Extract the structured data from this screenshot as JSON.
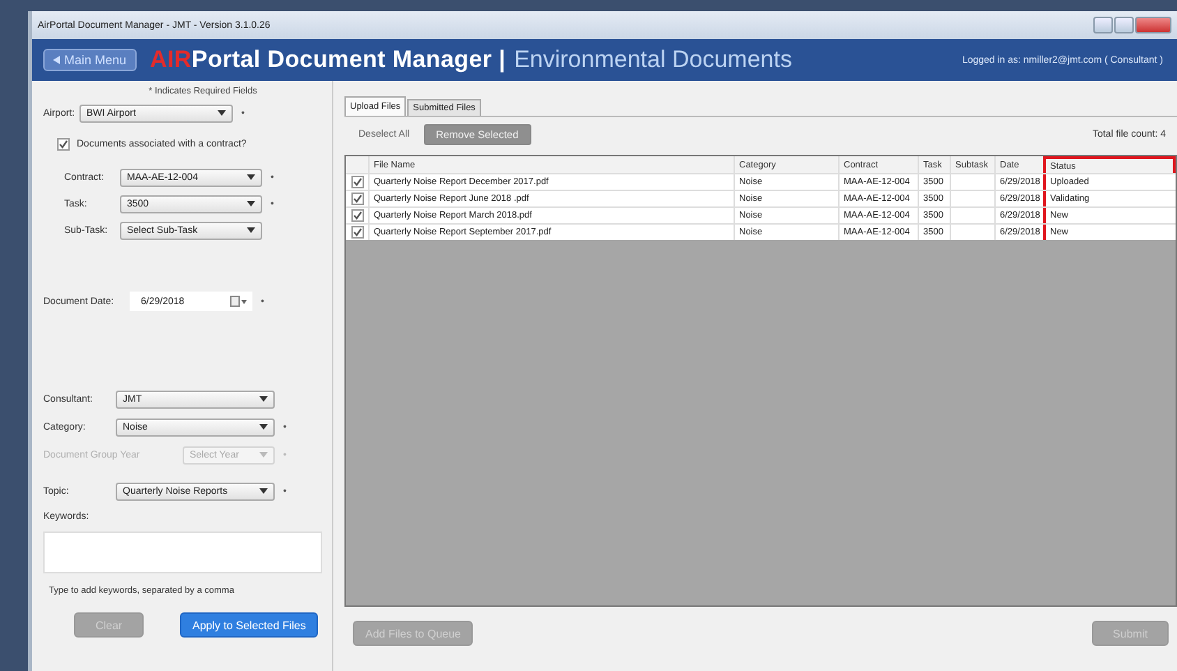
{
  "window": {
    "title": "AirPortal Document Manager - JMT - Version 3.1.0.26"
  },
  "header": {
    "menu_button": "Main Menu",
    "brand_accent": "AIR",
    "brand": "Portal Document Manager",
    "separator": "|",
    "section": "Environmental Documents",
    "login": "Logged in as: nmiller2@jmt.com ( Consultant )"
  },
  "form": {
    "required_note": "* Indicates Required Fields",
    "airport": {
      "label": "Airport:",
      "value": "BWI Airport",
      "marker": "•"
    },
    "contract_check": {
      "label": "Documents associated with a contract?",
      "checked": true
    },
    "contract_fields": [
      {
        "label": "Contract:",
        "value": "MAA-AE-12-004",
        "marker": "•",
        "disabled": false
      },
      {
        "label": "Task:",
        "value": "3500",
        "marker": "•",
        "disabled": false
      },
      {
        "label": "Sub-Task:",
        "value": "Select Sub-Task",
        "disabled": false
      }
    ],
    "document_date": {
      "label": "Document Date:",
      "value": "6/29/2018",
      "marker": "•"
    },
    "detail_fields": [
      {
        "label": "Consultant:",
        "value": "JMT",
        "disabled": false
      },
      {
        "label": "Category:",
        "value": "Noise",
        "marker": "•",
        "disabled": false
      },
      {
        "label": "Document Group Year",
        "value": "Select Year",
        "marker": "•",
        "disabled": true
      },
      {
        "label": "Topic:",
        "value": "Quarterly Noise Reports",
        "marker": "•",
        "disabled": false
      }
    ],
    "keywords": {
      "label": "Keywords:",
      "hint": "Type to add keywords, separated by a comma"
    },
    "buttons": [
      {
        "label": "Clear",
        "disabled": true
      },
      {
        "label": "Apply to Selected Files",
        "disabled": false
      }
    ]
  },
  "tabs": [
    {
      "label": "Upload Files",
      "selected": true
    },
    {
      "label": "Submitted Files",
      "selected": false
    }
  ],
  "toolbar": {
    "buttons": [
      {
        "label": "Deselect All",
        "kind": "link",
        "disabled": false
      },
      {
        "label": "Remove Selected",
        "kind": "button",
        "disabled": true
      }
    ],
    "file_count": "Total file count: 4"
  },
  "table": {
    "columns": [
      {
        "label": "File Name",
        "highlighted": false
      },
      {
        "label": "Category",
        "highlighted": false
      },
      {
        "label": "Contract",
        "highlighted": false
      },
      {
        "label": "Task",
        "highlighted": false
      },
      {
        "label": "Subtask",
        "highlighted": false
      },
      {
        "label": "Date",
        "highlighted": false
      },
      {
        "label": "Status",
        "highlighted": true
      }
    ],
    "rows": [
      {
        "checked": true,
        "cells": [
          "Quarterly Noise Report December 2017.pdf",
          "Noise",
          "MAA-AE-12-004",
          "3500",
          "",
          "6/29/2018",
          "Uploaded"
        ]
      },
      {
        "checked": true,
        "cells": [
          "Quarterly Noise Report June 2018 .pdf",
          "Noise",
          "MAA-AE-12-004",
          "3500",
          "",
          "6/29/2018",
          "Validating"
        ]
      },
      {
        "checked": true,
        "cells": [
          "Quarterly Noise Report March 2018.pdf",
          "Noise",
          "MAA-AE-12-004",
          "3500",
          "",
          "6/29/2018",
          "New"
        ]
      },
      {
        "checked": true,
        "cells": [
          "Quarterly Noise Report September 2017.pdf",
          "Noise",
          "MAA-AE-12-004",
          "3500",
          "",
          "6/29/2018",
          "New"
        ]
      }
    ]
  },
  "footer_buttons": [
    {
      "label": "Add Files to Queue",
      "disabled": true
    },
    {
      "label": "Submit",
      "disabled": true
    }
  ]
}
